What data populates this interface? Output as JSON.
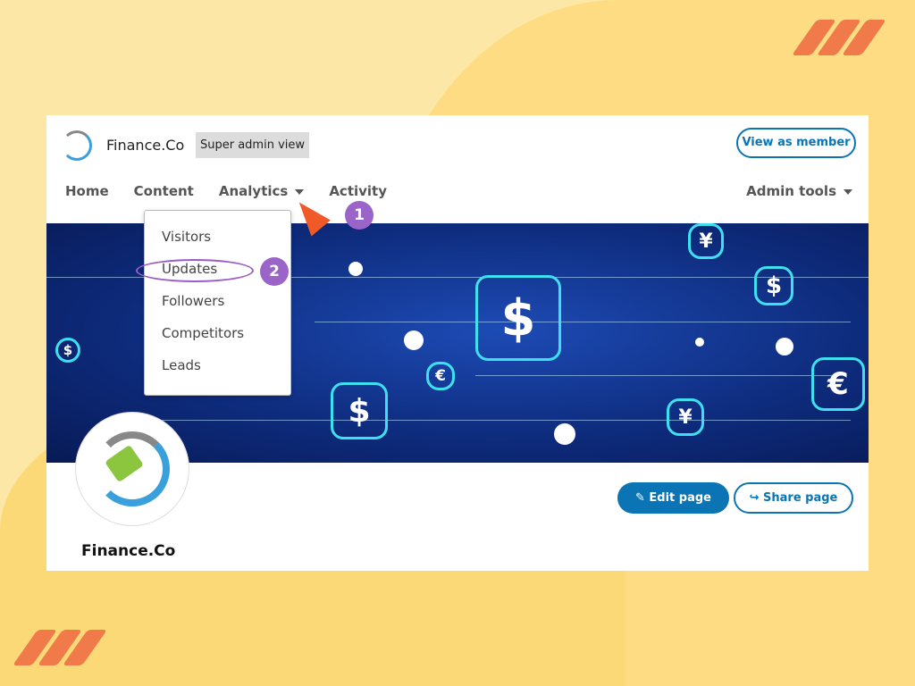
{
  "header": {
    "brand": "Finance.Co",
    "badge": "Super admin view",
    "view_as_member": "View as member"
  },
  "nav": {
    "items": [
      "Home",
      "Content",
      "Analytics",
      "Activity"
    ],
    "admin_tools": "Admin tools"
  },
  "analytics_menu": {
    "items": [
      "Visitors",
      "Updates",
      "Followers",
      "Competitors",
      "Leads"
    ],
    "highlighted": "Updates"
  },
  "annotations": {
    "step1": "1",
    "step2": "2"
  },
  "profile": {
    "name": "Finance.Co",
    "edit_page": "Edit page",
    "share_page": "Share page"
  },
  "banner": {
    "symbols": [
      "$",
      "¥",
      "€",
      "$",
      "$",
      "¥",
      "$",
      "€"
    ]
  },
  "colors": {
    "accent": "#0a74b5",
    "annotation": "#9b64c8",
    "cursor": "#f05a28"
  }
}
